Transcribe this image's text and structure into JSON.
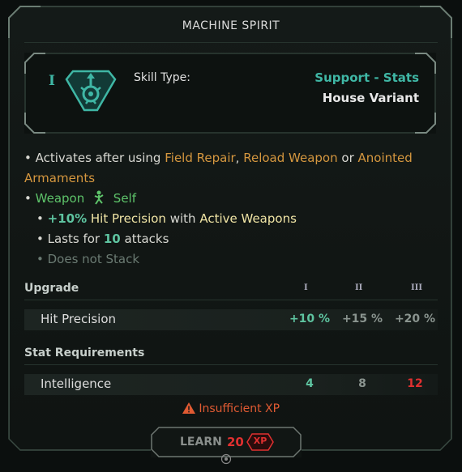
{
  "panel": {
    "title": "MACHINE SPIRIT"
  },
  "skill": {
    "tier": "I",
    "icon": "machine-spirit-emblem-icon",
    "type_label": "Skill Type:",
    "type_value": "Support - Stats",
    "variant": "House Variant"
  },
  "description": {
    "activates_prefix": "• Activates after using",
    "trigger_1": "Field Repair",
    "sep_1": ",",
    "trigger_2": "Reload Weapon",
    "sep_2": "or",
    "trigger_3": "Anointed Armaments",
    "target_bullet": "•",
    "target_1": "Weapon",
    "target_icon": "self-figure-icon",
    "target_2": "Self",
    "effect_bullet": "•",
    "effect_value": "+10%",
    "effect_stat": "Hit Precision",
    "effect_with": "with",
    "effect_target": "Active Weapons",
    "duration_prefix": "• Lasts for",
    "duration_value": "10",
    "duration_suffix": "attacks",
    "stack_note": "• Does not Stack"
  },
  "upgrade": {
    "heading": "Upgrade",
    "levels": [
      "I",
      "II",
      "III"
    ],
    "rows": [
      {
        "label": "Hit Precision",
        "values": [
          "+10 %",
          "+15 %",
          "+20 %"
        ]
      }
    ]
  },
  "requirements": {
    "heading": "Stat Requirements",
    "rows": [
      {
        "label": "Intelligence",
        "values": [
          "4",
          "8",
          "12"
        ]
      }
    ]
  },
  "warning": {
    "icon": "warning-triangle-icon",
    "text": "Insufficient XP"
  },
  "learn": {
    "label": "LEARN",
    "cost": "20",
    "currency": "XP"
  },
  "colors": {
    "accent_teal": "#3fb7a5",
    "gold": "#d5973f",
    "green": "#5ec46a",
    "danger_red": "#e03030",
    "warning_orange": "#e05a32"
  }
}
